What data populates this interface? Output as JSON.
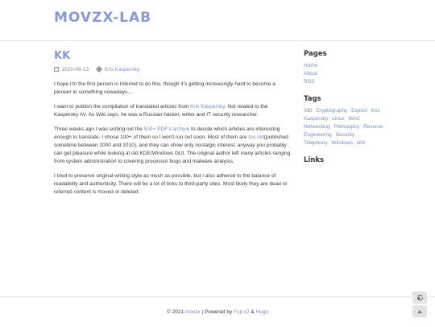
{
  "header": {
    "brand": "MOVZX-LAB"
  },
  "post": {
    "title": "KK",
    "date": "2020-08-13",
    "tag": "Kris Kaspersky",
    "p1": "I hope I'm the first person in Internet to do this, though it's getting increasingly hard to become a pioneer in something nowadays...",
    "p2_a": "I want to publish the compilation of translated articles from ",
    "p2_link": "Kris Kaspersky",
    "p2_b": ". Not related to the Kaspersky AV. As Wiki says, he was a Russian hacker, writer and IT security researcher.",
    "p3_a": "Three weeks ago I was sorting out the ",
    "p3_link1": "500+ PDF's archive",
    "p3_b": " to decide which articles are interesting enough to translate. I chose 100+ of them so I won't run out soon. Most of them are ",
    "p3_link2": "too old",
    "p3_c": "(published sometime between 2000 and 2010), and they can show only nostalgic interest; anyway you probably can get pleasure while looking at old KDE/Windows GUI. The original author left many articles ranging from system administration to covering processor bugs and malware analysis.",
    "p4": "I tried to preserve original writing style as much as possible, but I also adhered to the balance of readability and authenticity. There will be a lot of links to third-party sites. Most likely they are dead or referred content is moved or deleted."
  },
  "sidebar": {
    "pages_title": "Pages",
    "pages": [
      "Home",
      "About",
      "RSS"
    ],
    "tags_title": "Tags",
    "tags": [
      "ABI",
      "Cryptography",
      "Exploit",
      "Kris",
      "Kaspersky",
      "Linux",
      "MAC",
      "Networking",
      "Philosophy",
      "Reverse Engineering",
      "Security",
      "Telephony",
      "Windows",
      "x86"
    ],
    "links_title": "Links"
  },
  "footer": {
    "copy": "© 2021 ",
    "author": "movzx",
    "powered": " | Powered by ",
    "theme": "Fuji-v2",
    "amp": " & ",
    "engine": "Hugo"
  },
  "icons": {
    "date": "calendar-icon",
    "tag": "tag-icon",
    "theme": "theme-toggle-icon",
    "top": "arrow-up-icon"
  }
}
